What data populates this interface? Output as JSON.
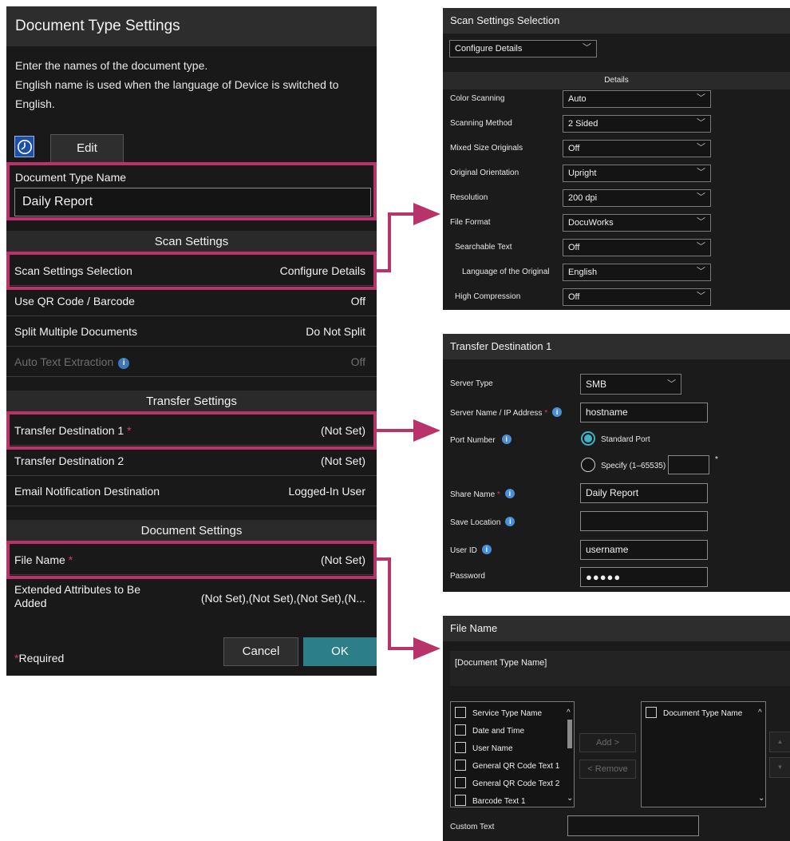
{
  "main": {
    "title": "Document Type Settings",
    "description": [
      "Enter the names of the document type.",
      "English name is used when the language of Device is switched to",
      "English."
    ],
    "edit_label": "Edit",
    "doc_type_name_label": "Document Type Name",
    "doc_type_name_value": "Daily Report",
    "scan_section": {
      "title": "Scan Settings",
      "rows": [
        {
          "label": "Scan Settings Selection",
          "value": "Configure Details"
        },
        {
          "label": "Use QR Code / Barcode",
          "value": "Off"
        },
        {
          "label": "Split Multiple Documents",
          "value": "Do Not Split"
        },
        {
          "label": "Auto Text Extraction",
          "value": "Off",
          "disabled": true
        }
      ]
    },
    "transfer_section": {
      "title": "Transfer Settings",
      "rows": [
        {
          "label": "Transfer Destination 1",
          "value": "(Not Set)",
          "required": true
        },
        {
          "label": "Transfer Destination 2",
          "value": "(Not Set)"
        },
        {
          "label": "Email Notification Destination",
          "value": "Logged-In User"
        }
      ]
    },
    "document_section": {
      "title": "Document Settings",
      "rows": [
        {
          "label": "File Name",
          "value": "(Not Set)",
          "required": true
        }
      ],
      "extended_label": "Extended Attributes to Be Added",
      "extended_value": "(Not Set),(Not Set),(Not Set),(N..."
    },
    "required_marker": "*",
    "required_note": "Required",
    "cancel_label": "Cancel",
    "ok_label": "OK"
  },
  "scan_panel": {
    "title": "Scan Settings Selection",
    "selection": "Configure Details",
    "details_header": "Details",
    "fields": [
      {
        "label": "Color Scanning",
        "value": "Auto"
      },
      {
        "label": "Scanning Method",
        "value": "2 Sided"
      },
      {
        "label": "Mixed Size Originals",
        "value": "Off"
      },
      {
        "label": "Original Orientation",
        "value": "Upright"
      },
      {
        "label": "Resolution",
        "value": "200 dpi"
      },
      {
        "label": "File Format",
        "value": "DocuWorks"
      },
      {
        "label": "Searchable Text",
        "value": "Off"
      },
      {
        "label": "Language of the Original",
        "value": "English"
      },
      {
        "label": "High Compression",
        "value": "Off"
      }
    ]
  },
  "transfer_panel": {
    "title": "Transfer Destination 1",
    "server_type_label": "Server Type",
    "server_type_value": "SMB",
    "server_name_label": "Server Name / IP Address",
    "server_name_value": "hostname",
    "port_label": "Port Number",
    "port_standard": "Standard Port",
    "port_specify": "Specify (1–65535)",
    "share_label": "Share Name",
    "share_value": "Daily Report",
    "save_location_label": "Save Location",
    "user_id_label": "User ID",
    "user_id_value": "username",
    "password_label": "Password",
    "password_mask": "●●●●●"
  },
  "file_panel": {
    "title": "File Name",
    "preview": "[Document Type Name]",
    "available_items": [
      "Service Type Name",
      "Date and Time",
      "User Name",
      "General QR Code Text 1",
      "General QR Code Text 2",
      "Barcode Text 1"
    ],
    "selected_items": [
      "Document Type Name"
    ],
    "add_label": "Add",
    "remove_label": "Remove",
    "custom_text_label": "Custom Text"
  },
  "colors": {
    "highlight": "#b8336a",
    "ok_button": "#2c7f88",
    "info": "#4a90d9",
    "radio_on": "#3db3c4"
  }
}
